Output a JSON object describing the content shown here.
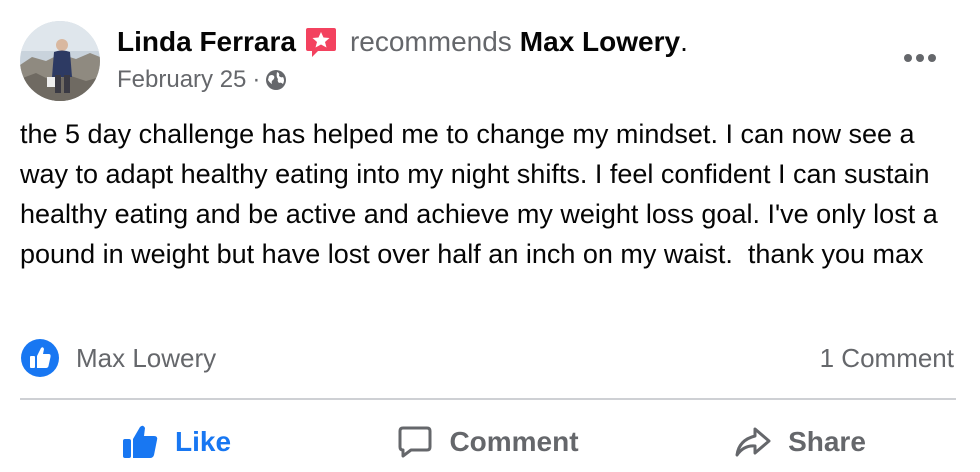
{
  "colors": {
    "accent": "#1877f2",
    "text": "#050505",
    "secondary": "#65676b",
    "badge": "#f3425f",
    "divider": "#ced0d4"
  },
  "header": {
    "author": "Linda Ferrara",
    "action_text": "recommends",
    "page": "Max Lowery",
    "period": ".",
    "date": "February 25",
    "separator": "·",
    "privacy_icon": "globe-icon",
    "badge_icon": "star-badge-icon",
    "more_icon": "more-horizontal-icon"
  },
  "body": {
    "text": "the 5 day challenge has helped me to change my mindset. I can now see a way to adapt healthy eating into my night shifts. I feel confident I can sustain healthy eating and be active and achieve my weight loss goal. I've only lost a pound in weight but have lost over half an inch on my waist.  thank you max"
  },
  "reactions": {
    "icon": "like-reaction-icon",
    "reactor": "Max Lowery",
    "comments": "1 Comment"
  },
  "actions": {
    "like": "Like",
    "comment": "Comment",
    "share": "Share"
  }
}
